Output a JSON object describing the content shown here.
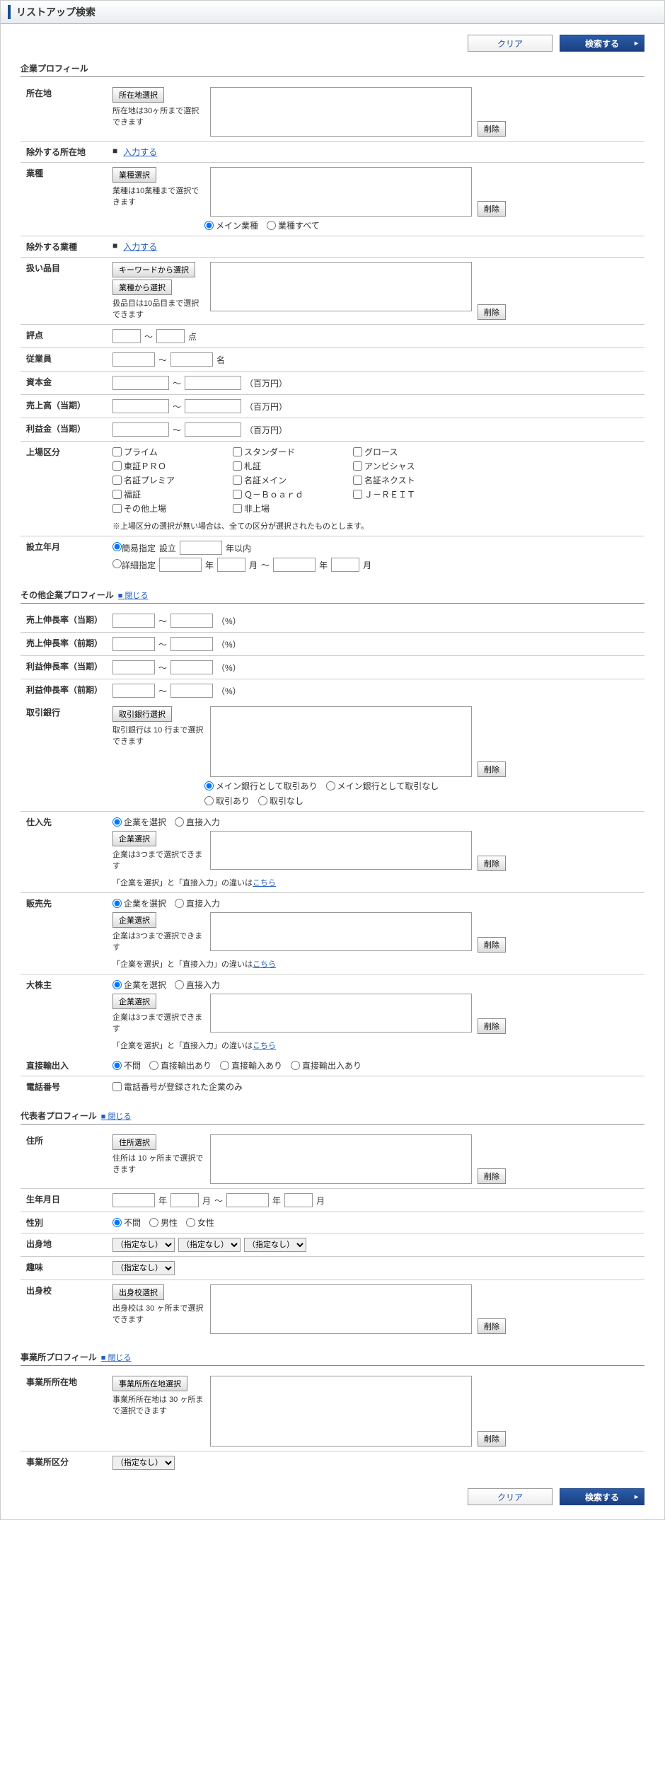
{
  "title": "リストアップ検索",
  "buttons": {
    "clear": "クリア",
    "search": "検索する",
    "delete": "削除"
  },
  "company": {
    "heading": "企業プロフィール",
    "location": {
      "label": "所在地",
      "select_btn": "所在地選択",
      "note": "所在地は30ヶ所まで選択できます"
    },
    "exclude_location": {
      "label": "除外する所在地",
      "link": "入力する"
    },
    "industry": {
      "label": "業種",
      "select_btn": "業種選択",
      "note": "業種は10業種まで選択できます",
      "radio_main": "メイン業種",
      "radio_all": "業種すべて"
    },
    "exclude_industry": {
      "label": "除外する業種",
      "link": "入力する"
    },
    "items": {
      "label": "扱い品目",
      "btn1": "キーワードから選択",
      "btn2": "業種から選択",
      "note": "扱品目は10品目まで選択できます"
    },
    "score": {
      "label": "評点",
      "sep": "～",
      "unit": "点"
    },
    "employees": {
      "label": "従業員",
      "sep": "～",
      "unit": "名"
    },
    "capital": {
      "label": "資本金",
      "sep": "～",
      "unit": "（百万円）"
    },
    "sales": {
      "label": "売上高（当期）",
      "sep": "～",
      "unit": "（百万円）"
    },
    "profit": {
      "label": "利益金（当期）",
      "sep": "～",
      "unit": "（百万円）"
    },
    "listing": {
      "label": "上場区分",
      "opts": [
        "プライム",
        "スタンダード",
        "グロース",
        "東証ＰＲＯ",
        "札証",
        "アンビシャス",
        "名証プレミア",
        "名証メイン",
        "名証ネクスト",
        "福証",
        "Ｑ－Ｂｏａｒｄ",
        "Ｊ－ＲＥＩＴ",
        "その他上場",
        "非上場"
      ],
      "note": "※上場区分の選択が無い場合は、全ての区分が選択されたものとします。"
    },
    "founded": {
      "label": "設立年月",
      "simple": "簡易指定",
      "simple_lbl": "設立",
      "simple_unit": "年以内",
      "detail": "詳細指定",
      "y": "年",
      "m": "月",
      "sep": "～"
    }
  },
  "other": {
    "heading": "その他企業プロフィール",
    "toggle": "閉じる",
    "rows": [
      {
        "label": "売上伸長率（当期）",
        "sep": "～",
        "unit": "（%）"
      },
      {
        "label": "売上伸長率（前期）",
        "sep": "～",
        "unit": "（%）"
      },
      {
        "label": "利益伸長率（当期）",
        "sep": "～",
        "unit": "（%）"
      },
      {
        "label": "利益伸長率（前期）",
        "sep": "～",
        "unit": "（%）"
      }
    ],
    "bank": {
      "label": "取引銀行",
      "btn": "取引銀行選択",
      "note": "取引銀行は 10 行まで選択できます",
      "r1": "メイン銀行として取引あり",
      "r2": "メイン銀行として取引なし",
      "r3": "取引あり",
      "r4": "取引なし"
    },
    "supplier": {
      "label": "仕入先",
      "r1": "企業を選択",
      "r2": "直接入力",
      "btn": "企業選択",
      "note": "企業は3つまで選択できます",
      "help": "「企業を選択」と「直接入力」の違いは",
      "help_link": "こちら"
    },
    "customer": {
      "label": "販売先",
      "r1": "企業を選択",
      "r2": "直接入力",
      "btn": "企業選択",
      "note": "企業は3つまで選択できます",
      "help": "「企業を選択」と「直接入力」の違いは",
      "help_link": "こちら"
    },
    "shareholder": {
      "label": "大株主",
      "r1": "企業を選択",
      "r2": "直接入力",
      "btn": "企業選択",
      "note": "企業は3つまで選択できます",
      "help": "「企業を選択」と「直接入力」の違いは",
      "help_link": "こちら"
    },
    "export": {
      "label": "直接輸出入",
      "r1": "不問",
      "r2": "直接輸出あり",
      "r3": "直接輸入あり",
      "r4": "直接輸出入あり"
    },
    "phone": {
      "label": "電話番号",
      "chk": "電話番号が登録された企業のみ"
    }
  },
  "rep": {
    "heading": "代表者プロフィール",
    "toggle": "閉じる",
    "address": {
      "label": "住所",
      "btn": "住所選択",
      "note": "住所は 10 ヶ所まで選択できます"
    },
    "birth": {
      "label": "生年月日",
      "y": "年",
      "m": "月",
      "sep": "～"
    },
    "gender": {
      "label": "性別",
      "r1": "不問",
      "r2": "男性",
      "r3": "女性"
    },
    "origin": {
      "label": "出身地",
      "opt": "（指定なし）"
    },
    "hobby": {
      "label": "趣味",
      "opt": "（指定なし）"
    },
    "school": {
      "label": "出身校",
      "btn": "出身校選択",
      "note": "出身校は 30 ヶ所まで選択できます"
    }
  },
  "office": {
    "heading": "事業所プロフィール",
    "toggle": "閉じる",
    "location": {
      "label": "事業所所在地",
      "btn": "事業所所在地選択",
      "note": "事業所所在地は 30 ヶ所まで選択できます"
    },
    "type": {
      "label": "事業所区分",
      "opt": "（指定なし）"
    }
  }
}
